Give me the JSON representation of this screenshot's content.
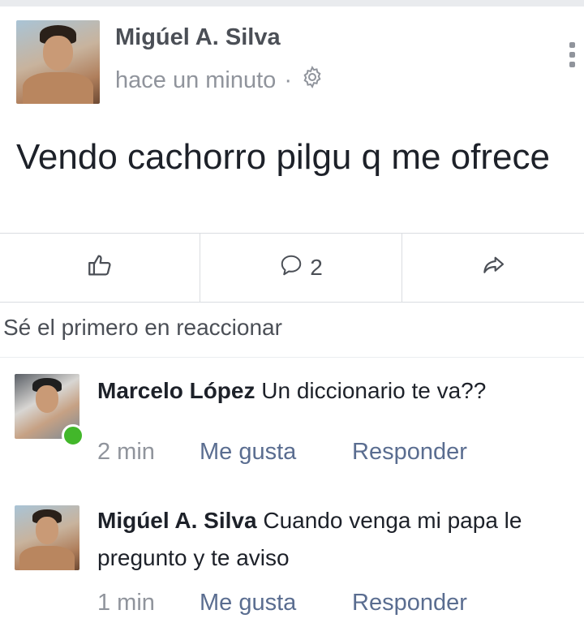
{
  "post": {
    "author": "Migúel A. Silva",
    "time": "hace un minuto",
    "separator": "·",
    "text": "Vendo cachorro pilgu q me ofrece",
    "icons": {
      "privacy": "gear-icon",
      "menu": "more-options-icon"
    }
  },
  "actions": {
    "like_icon": "thumbs-up-icon",
    "comment_icon": "comment-icon",
    "comment_count": "2",
    "share_icon": "share-icon"
  },
  "reactions": {
    "prompt": "Sé el primero en reaccionar"
  },
  "comments": [
    {
      "author": "Marcelo López",
      "text": "Un diccionario te va??",
      "time": "2 min",
      "like_label": "Me gusta",
      "reply_label": "Responder",
      "online": true
    },
    {
      "author": "Migúel A. Silva",
      "text": "Cuando venga mi papa le pregunto y te aviso",
      "time": "1 min",
      "like_label": "Me gusta",
      "reply_label": "Responder",
      "online": false
    }
  ],
  "colors": {
    "online": "#42b72a",
    "link": "#5a6d90",
    "meta": "#90949c"
  }
}
